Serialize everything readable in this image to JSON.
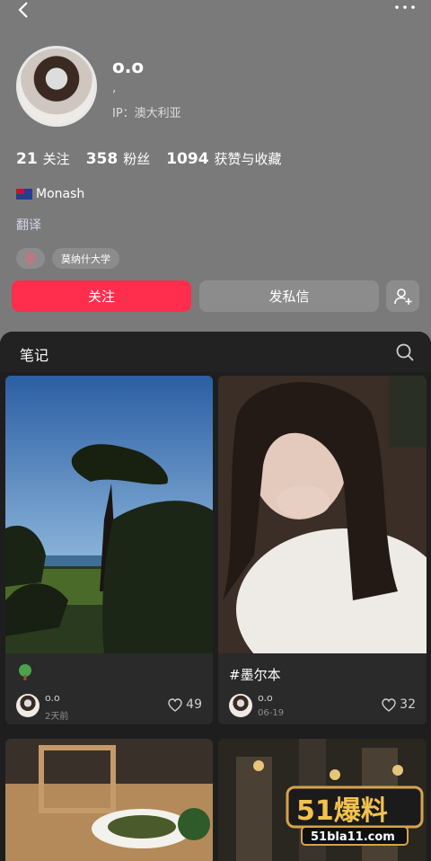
{
  "header": {
    "back_icon": "chevron-left-icon",
    "more_icon": "more-dots-icon"
  },
  "profile": {
    "username": "o.o",
    "bio_line": ",",
    "ip": "IP：澳大利亚",
    "stats": [
      {
        "num": "21",
        "label": "关注"
      },
      {
        "num": "358",
        "label": "粉丝"
      },
      {
        "num": "1094",
        "label": "获赞与收藏"
      }
    ],
    "bio": "Monash",
    "translate": "翻译",
    "tags": [
      "莫纳什大学"
    ]
  },
  "actions": {
    "follow": "关注",
    "message": "发私信"
  },
  "notes": {
    "title": "笔记",
    "cards": [
      {
        "title": "",
        "author": "o.o",
        "date": "2天前",
        "likes": "49"
      },
      {
        "title": "#墨尔本",
        "author": "o.o",
        "date": "06-19",
        "likes": "32"
      }
    ]
  },
  "watermark": {
    "brand": "51爆料",
    "url": "51bla11.com"
  },
  "colors": {
    "accent": "#ff2e4d",
    "background": "#7a7a7a",
    "panel": "#1e1e1e"
  }
}
